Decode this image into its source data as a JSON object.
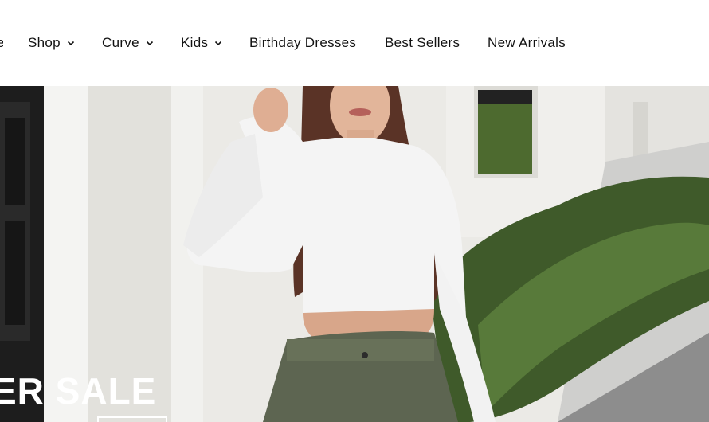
{
  "nav": {
    "items": [
      {
        "label": "e",
        "has_dropdown": false
      },
      {
        "label": "Shop",
        "has_dropdown": true
      },
      {
        "label": "Curve",
        "has_dropdown": true
      },
      {
        "label": "Kids",
        "has_dropdown": true
      },
      {
        "label": "Birthday Dresses",
        "has_dropdown": false
      },
      {
        "label": "Best Sellers",
        "has_dropdown": false
      },
      {
        "label": "New Arrivals",
        "has_dropdown": false
      }
    ]
  },
  "hero": {
    "title": "ER SALE"
  },
  "colors": {
    "nav_text": "#121212",
    "hero_text": "#ffffff"
  }
}
